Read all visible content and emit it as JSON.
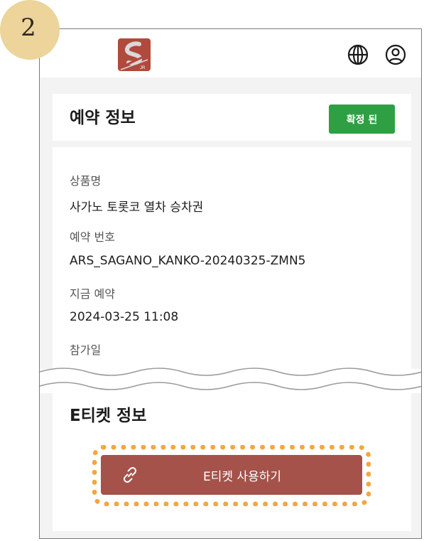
{
  "step": {
    "number": "2"
  },
  "header": {
    "logo_icon": "sagano-railway-logo",
    "globe_icon": "globe-icon",
    "user_icon": "user-circle-icon"
  },
  "reservation": {
    "title": "예약 정보",
    "status": "확정 된",
    "fields": [
      {
        "label": "상품명",
        "value": "사가노 토롯코 열차 승차권"
      },
      {
        "label": "예약 번호",
        "value": "ARS_SAGANO_KANKO-20240325-ZMN5"
      },
      {
        "label": "지금 예약",
        "value": "2024-03-25 11:08"
      },
      {
        "label": "참가일",
        "value": ""
      }
    ]
  },
  "eticket": {
    "title": "E티켓 정보",
    "button_label": "E티켓 사용하기",
    "button_icon": "link-icon"
  },
  "colors": {
    "step_badge": "#ecd49a",
    "status_green": "#2ea043",
    "button_brown": "#a4524a",
    "highlight_orange": "#f4a640",
    "logo_red": "#b04a3c"
  }
}
